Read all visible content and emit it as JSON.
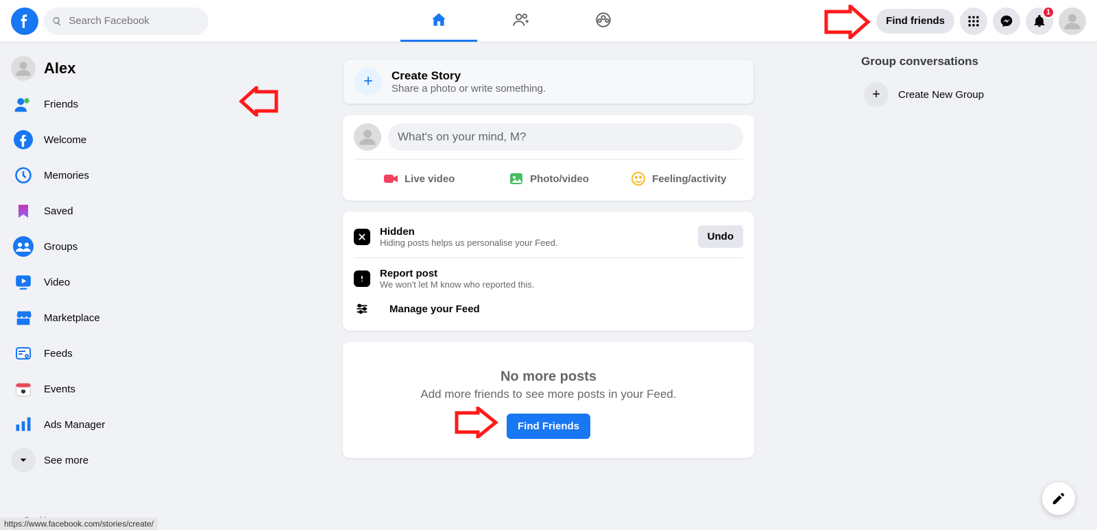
{
  "header": {
    "search_placeholder": "Search Facebook",
    "find_friends_label": "Find friends",
    "notifications_badge": "1"
  },
  "sidebar": {
    "profile_name": "Alex",
    "items": [
      {
        "label": "Friends"
      },
      {
        "label": "Welcome"
      },
      {
        "label": "Memories"
      },
      {
        "label": "Saved"
      },
      {
        "label": "Groups"
      },
      {
        "label": "Video"
      },
      {
        "label": "Marketplace"
      },
      {
        "label": "Feeds"
      },
      {
        "label": "Events"
      },
      {
        "label": "Ads Manager"
      }
    ],
    "see_more_label": "See more",
    "footer_cookies": "Cookies ·"
  },
  "story": {
    "title": "Create Story",
    "sub": "Share a photo or write something."
  },
  "composer": {
    "placeholder": "What's on your mind, M?",
    "live_label": "Live video",
    "photo_label": "Photo/video",
    "feeling_label": "Feeling/activity"
  },
  "hidden_card": {
    "hidden_title": "Hidden",
    "hidden_sub": "Hiding posts helps us personalise your Feed.",
    "undo_label": "Undo",
    "report_title": "Report post",
    "report_sub": "We won't let M know who reported this.",
    "manage_label": "Manage your Feed"
  },
  "nomore": {
    "title": "No more posts",
    "sub": "Add more friends to see more posts in your Feed.",
    "button": "Find Friends"
  },
  "rightcol": {
    "title": "Group conversations",
    "create_label": "Create New Group"
  },
  "status_url": "https://www.facebook.com/stories/create/"
}
